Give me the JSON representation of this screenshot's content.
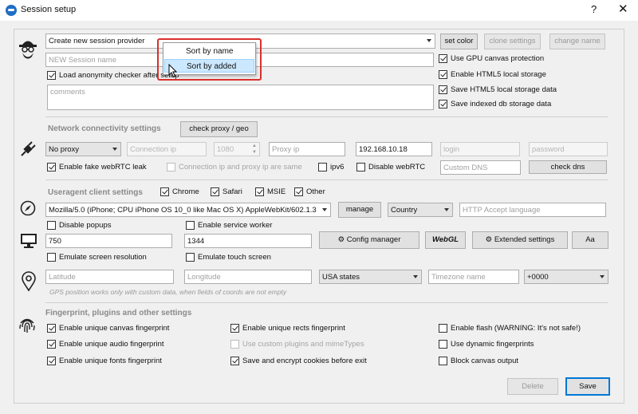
{
  "window": {
    "title": "Session setup",
    "help": "?",
    "close": "✕"
  },
  "header": {
    "provider_select": "Create new session provider",
    "set_color": "set color",
    "clone_settings": "clone settings",
    "change_name": "change name",
    "session_name_placeholder": "NEW Session name",
    "load_anonymity": "Load anonymity checker after setup",
    "comments_placeholder": "comments",
    "use_gpu": "Use GPU canvas protection",
    "enable_html5": "Enable HTML5 local storage",
    "save_html5": "Save HTML5 local storage data",
    "save_indexed": "Save indexed db storage data"
  },
  "sort_menu": {
    "items": [
      "Sort by name",
      "Sort by added"
    ],
    "selected": "Sort by added"
  },
  "network": {
    "title": "Network connectivity settings",
    "check_proxy": "check proxy / geo",
    "proxy_select": "No proxy",
    "connection_ip_placeholder": "Connection ip",
    "port": "1080",
    "proxy_ip_placeholder": "Proxy ip",
    "local_ip": "192.168.10.18",
    "login_placeholder": "login",
    "password_placeholder": "password",
    "fake_webrtc": "Enable fake webRTC leak",
    "ip_same": "Connection ip and proxy ip are same",
    "ipv6": "ipv6",
    "disable_webrtc": "Disable webRTC",
    "custom_dns_placeholder": "Custom DNS",
    "check_dns": "check dns"
  },
  "useragent": {
    "title": "Useragent client settings",
    "browsers": [
      "Chrome",
      "Safari",
      "MSIE",
      "Other"
    ],
    "ua_string": "Mozilla/5.0 (iPhone; CPU iPhone OS 10_0 like Mac OS X) AppleWebKit/602.1.3",
    "manage": "manage",
    "country": "Country",
    "accept_language_placeholder": "HTTP Accept language",
    "disable_popups": "Disable popups",
    "enable_service_worker": "Enable service worker",
    "width": "750",
    "height": "1344",
    "config_manager": "Config manager",
    "webgl": "WebGL",
    "extended_settings": "Extended settings",
    "font_button": "Aa",
    "emulate_resolution": "Emulate screen resolution",
    "emulate_touch": "Emulate touch screen"
  },
  "geo": {
    "latitude_placeholder": "Latitude",
    "longitude_placeholder": "Longitude",
    "states_select": "USA states",
    "timezone_placeholder": "Timezone name",
    "offset_select": "+0000",
    "hint": "GPS position works only with custom data, when fields of coords are not empty"
  },
  "fingerprint": {
    "title": "Fingerprint, plugins and other settings",
    "canvas": "Enable unique canvas fingerprint",
    "audio": "Enable unique audio fingerprint",
    "fonts": "Enable unique fonts fingerprint",
    "rects": "Enable unique rects fingerprint",
    "custom_plugins": "Use custom plugins and mimeTypes",
    "save_cookies": "Save and encrypt cookies before exit",
    "flash": "Enable flash (WARNING: It's not safe!)",
    "dynamic": "Use dynamic fingerprints",
    "block_canvas": "Block canvas output"
  },
  "footer": {
    "delete": "Delete",
    "save": "Save"
  },
  "colors": {
    "accent": "#0078d7",
    "highlight": "#cce8ff",
    "popup_border": "#d9302e"
  }
}
